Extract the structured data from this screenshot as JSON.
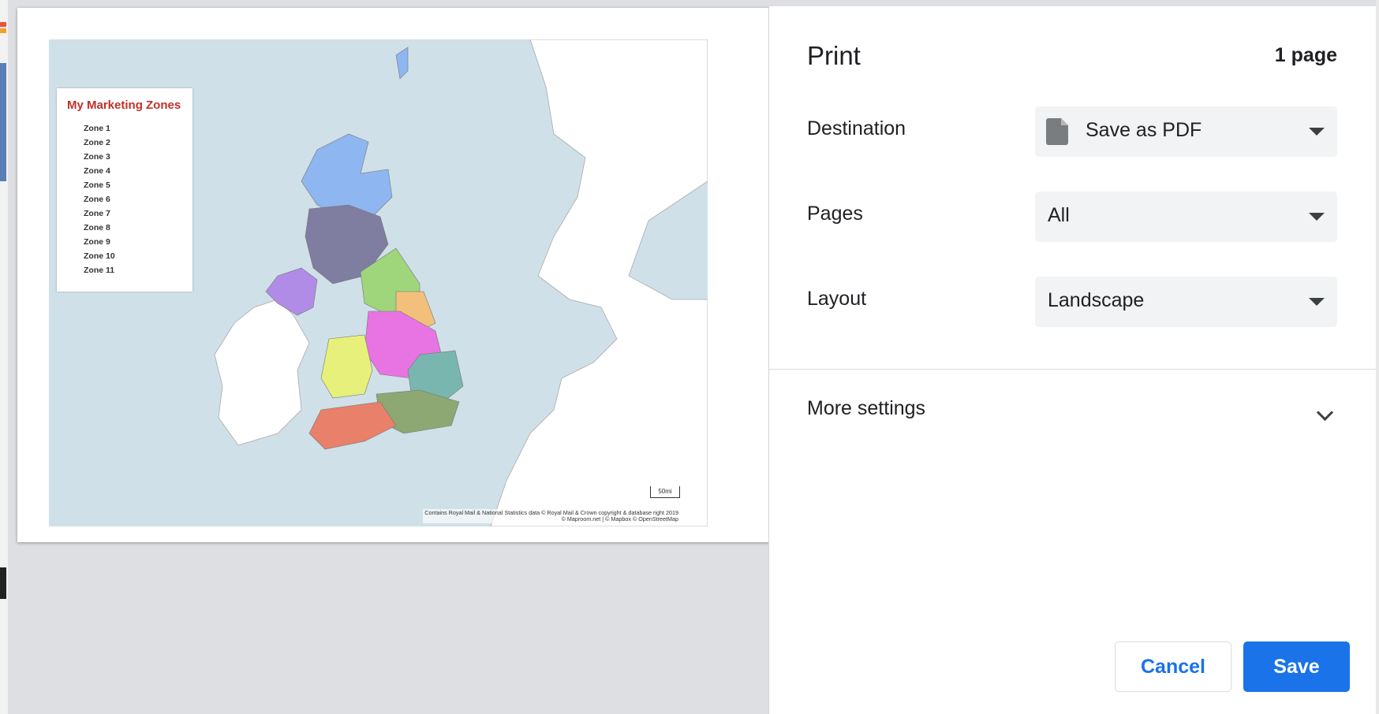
{
  "dialog": {
    "title": "Print",
    "page_count": "1 page"
  },
  "settings": {
    "destination": {
      "label": "Destination",
      "value": "Save as PDF",
      "icon": "file-icon"
    },
    "pages": {
      "label": "Pages",
      "value": "All"
    },
    "layout": {
      "label": "Layout",
      "value": "Landscape"
    },
    "more": {
      "label": "More settings"
    }
  },
  "buttons": {
    "cancel": "Cancel",
    "save": "Save"
  },
  "preview": {
    "legend_title": "My Marketing Zones",
    "zones": [
      "Zone 1",
      "Zone 2",
      "Zone 3",
      "Zone 4",
      "Zone 5",
      "Zone 6",
      "Zone 7",
      "Zone 8",
      "Zone 9",
      "Zone 10",
      "Zone 11"
    ],
    "scale": "50mi",
    "attribution_line1": "Contains Royal Mail & National Statistics data © Royal Mail & Crown copyright & database right 2019",
    "attribution_line2": "© Maproom.net | © Mapbox © OpenStreetMap"
  },
  "colors": {
    "accent": "#1a73e8",
    "legend_title": "#c0302a",
    "sea": "#cfe0e8"
  }
}
